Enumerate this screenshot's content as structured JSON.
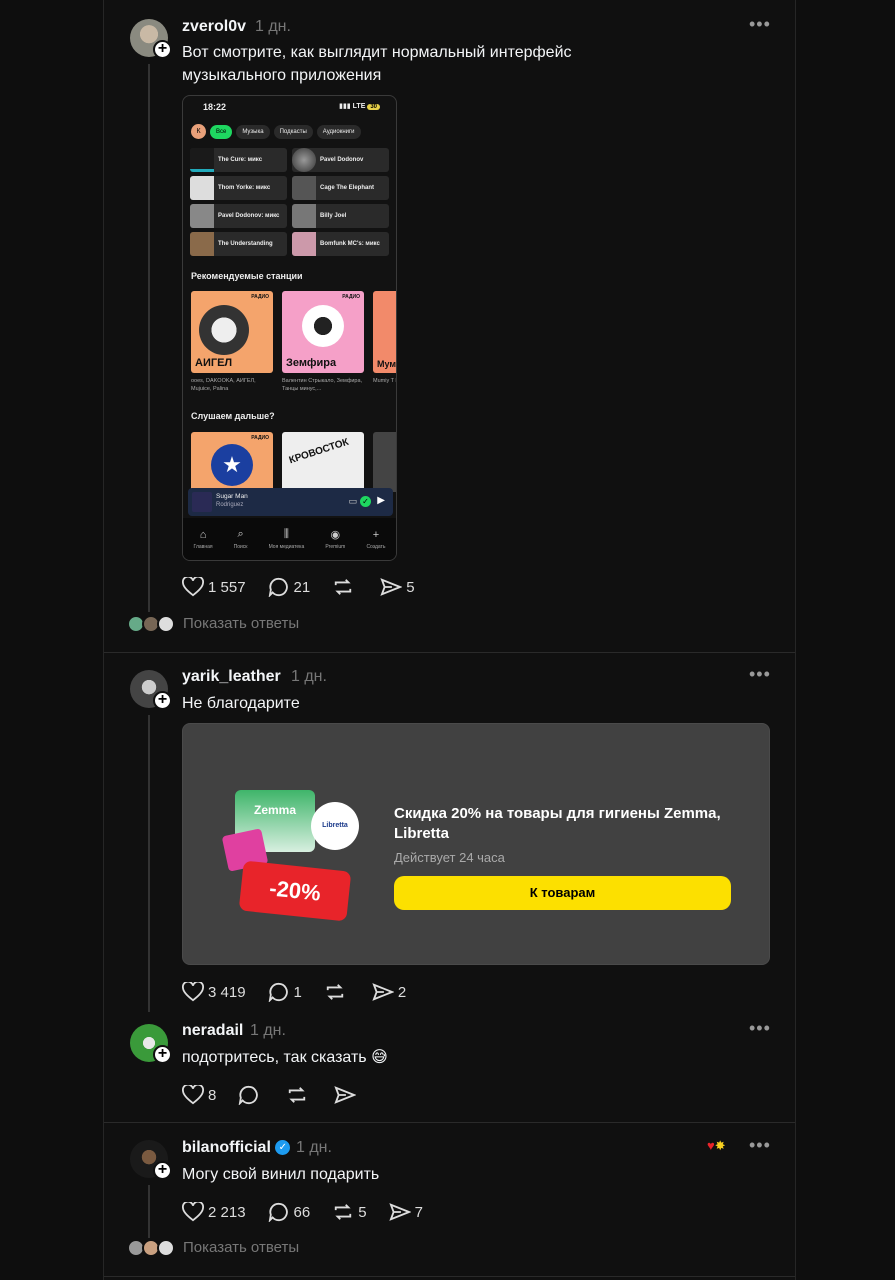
{
  "posts": [
    {
      "username": "zverol0v",
      "time": "1 дн.",
      "text": "Вот смотрите, как выглядит нормальный интерфейс музыкального приложения",
      "likes": "1 557",
      "replies": "21",
      "reposts": "",
      "shares": "5",
      "show_replies": "Показать ответы"
    },
    {
      "username": "yarik_leather",
      "time": "1 дн.",
      "text": "Не благодарите",
      "likes": "3 419",
      "replies": "1",
      "reposts": "",
      "shares": "2"
    },
    {
      "username": "neradail",
      "time": "1 дн.",
      "text": "подотритесь, так сказать 😅",
      "likes": "8",
      "replies": "",
      "reposts": "",
      "shares": ""
    },
    {
      "username": "bilanofficial",
      "time": "1 дн.",
      "text": "Могу свой винил подарить",
      "likes": "2 213",
      "replies": "66",
      "reposts": "5",
      "shares": "7",
      "show_replies": "Показать ответы"
    }
  ],
  "phone": {
    "time": "18:22",
    "network": "LTE",
    "battery": "30",
    "avatar_letter": "К",
    "chips": [
      "Все",
      "Музыка",
      "Подкасты",
      "Аудиокниги"
    ],
    "tiles": [
      "The Cure: микс",
      "Pavel Dodonov",
      "Thom Yorke: микс",
      "Cage The Elephant",
      "Pavel Dodonov: микс",
      "Billy Joel",
      "The Understanding",
      "Bomfunk MC's: микс"
    ],
    "section1": "Рекомендуемые станции",
    "stations": [
      {
        "name": "АИГЕЛ",
        "badge": "РАДИО",
        "caption": "ooes, DAKOOKA, АИГЕЛ, Mujuice, Palina",
        "color": "#f4a46c"
      },
      {
        "name": "Земфира",
        "badge": "РАДИО",
        "caption": "Валентин Стрыкало, Земфира, Танцы минус,...",
        "color": "#f5a0c8"
      },
      {
        "name": "Мумий",
        "badge": "",
        "caption": "Mumiy T Nochny",
        "color": "#f28a6a"
      }
    ],
    "section2": "Слушаем дальше?",
    "continue": [
      {
        "name": "",
        "badge": "РАДИО",
        "color": "#f4a46c"
      },
      {
        "name": "КРОВОСТОК",
        "badge": "",
        "color": "#eeeeee"
      },
      {
        "name": "",
        "badge": "",
        "color": "#444444"
      }
    ],
    "player_title": "Sugar Man",
    "player_artist": "Rodriguez",
    "nav": [
      "Главная",
      "Поиск",
      "Моя медиатека",
      "Premium",
      "Создать"
    ]
  },
  "ad": {
    "title": "Скидка 20% на товары для гигиены Zemma, Libretta",
    "subtitle": "Действует 24 часа",
    "button": "К товарам",
    "discount": "-20%",
    "brand1": "Zemma",
    "brand2": "Libretta"
  }
}
